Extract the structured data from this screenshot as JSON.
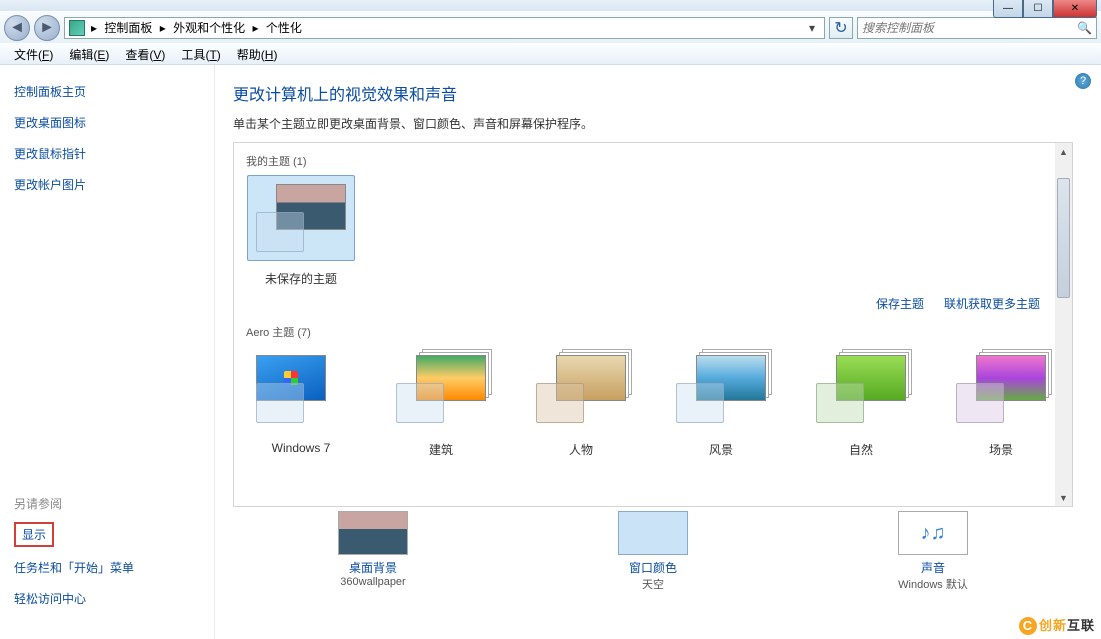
{
  "window": {
    "min": "—",
    "max": "☐",
    "close": "✕"
  },
  "breadcrumb": {
    "sep": "▸",
    "items": [
      "控制面板",
      "外观和个性化",
      "个性化"
    ]
  },
  "search": {
    "placeholder": "搜索控制面板"
  },
  "menus": [
    {
      "label": "文件",
      "key": "F"
    },
    {
      "label": "编辑",
      "key": "E"
    },
    {
      "label": "查看",
      "key": "V"
    },
    {
      "label": "工具",
      "key": "T"
    },
    {
      "label": "帮助",
      "key": "H"
    }
  ],
  "sidebar": {
    "home": "控制面板主页",
    "links": [
      "更改桌面图标",
      "更改鼠标指针",
      "更改帐户图片"
    ],
    "see_also_label": "另请参阅",
    "see_also": {
      "highlighted": "显示",
      "rest": [
        "任务栏和「开始」菜单",
        "轻松访问中心"
      ]
    }
  },
  "page": {
    "title": "更改计算机上的视觉效果和声音",
    "desc": "单击某个主题立即更改桌面背景、窗口颜色、声音和屏幕保护程序。"
  },
  "sections": {
    "my_themes_label": "我的主题 (1)",
    "aero_label": "Aero 主题 (7)"
  },
  "themes": {
    "unsaved": "未保存的主题",
    "aero": [
      "Windows 7",
      "建筑",
      "人物",
      "风景",
      "自然",
      "场景"
    ]
  },
  "actions": {
    "save": "保存主题",
    "online": "联机获取更多主题"
  },
  "settings": {
    "wallpaper": {
      "title": "桌面背景",
      "sub": "360wallpaper"
    },
    "color": {
      "title": "窗口颜色",
      "sub": "天空"
    },
    "sound": {
      "title": "声音",
      "sub": "Windows 默认"
    }
  },
  "watermark": {
    "badge": "C",
    "a": "创新",
    "b": "互联"
  }
}
